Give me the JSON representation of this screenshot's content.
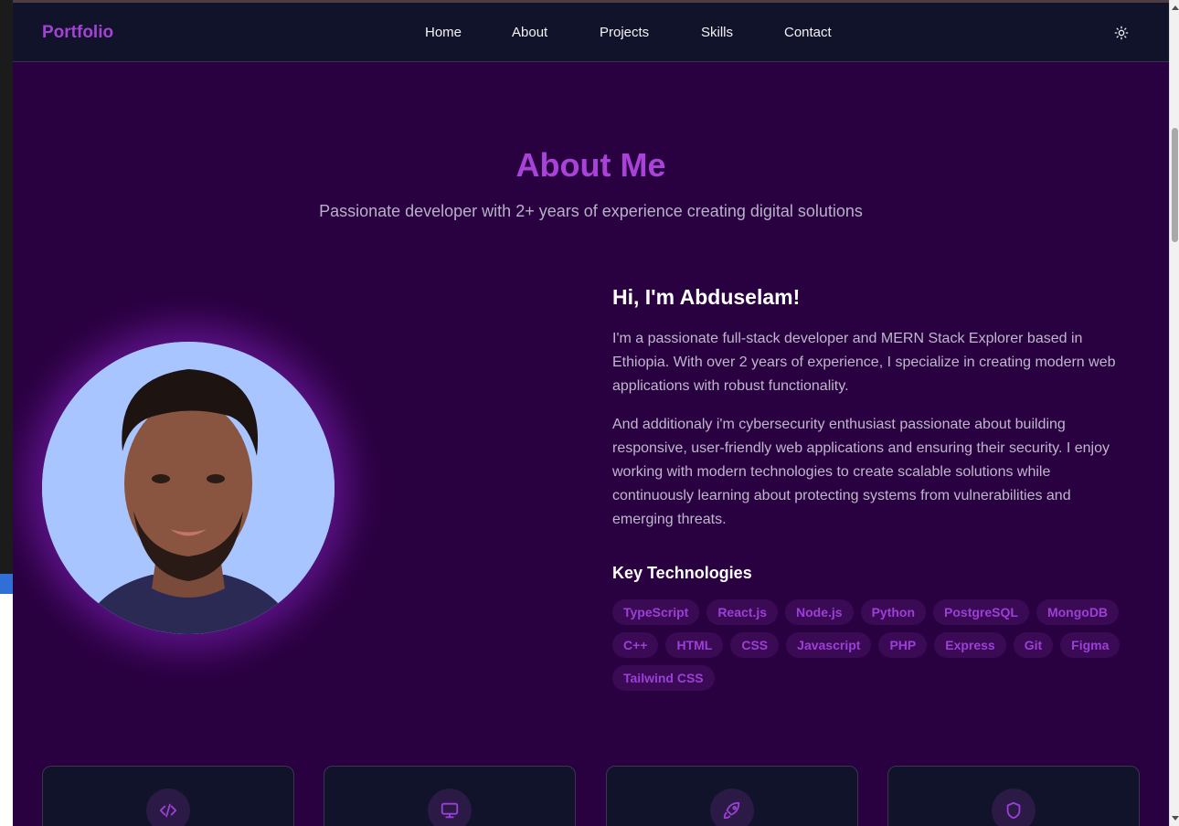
{
  "brand": {
    "logo": "Portfolio",
    "accent_color": "#a842d8",
    "background_color": "#2a0140"
  },
  "nav": {
    "links": [
      "Home",
      "About",
      "Projects",
      "Skills",
      "Contact"
    ],
    "theme_toggle_icon": "sun-icon"
  },
  "about": {
    "title": "About Me",
    "subtitle": "Passionate developer with 2+ years of experience creating digital solutions",
    "greeting": "Hi, I'm Abduselam!",
    "paragraph1": "I'm a passionate full-stack developer and MERN Stack Explorer based in Ethiopia. With over 2 years of experience, I specialize in creating modern web applications with robust functionality.",
    "paragraph2": "And additionaly i'm cybersecurity enthusiast passionate about building responsive, user-friendly web applications and ensuring their security. I enjoy working with modern technologies to create scalable solutions while continuously learning about protecting systems from vulnerabilities and emerging threats.",
    "key_technologies_heading": "Key Technologies",
    "technologies": [
      "TypeScript",
      "React.js",
      "Node.js",
      "Python",
      "PostgreSQL",
      "MongoDB",
      "C++",
      "HTML",
      "CSS",
      "Javascript",
      "PHP",
      "Express",
      "Git",
      "Figma",
      "Tailwind CSS"
    ]
  },
  "cards": [
    {
      "icon": "code-icon"
    },
    {
      "icon": "monitor-icon"
    },
    {
      "icon": "rocket-icon"
    },
    {
      "icon": "shield-icon"
    }
  ]
}
